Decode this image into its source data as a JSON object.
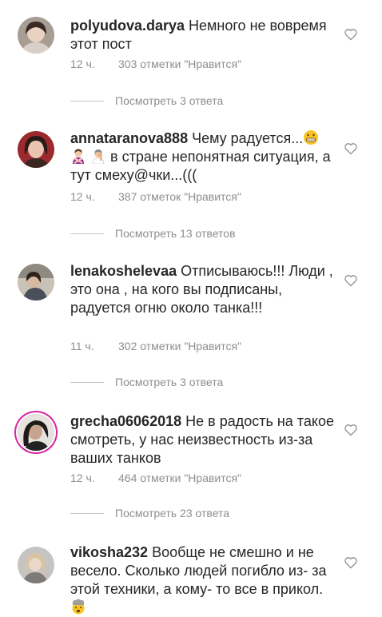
{
  "comments": [
    {
      "username": "polyudova.darya",
      "text": "Немного не вовремя этот пост",
      "time": "12 ч.",
      "likes": "303 отметки \"Нравится\"",
      "replies": "Посмотреть 3 ответа",
      "avatar_icon": "user-avatar-icon"
    },
    {
      "username": "annataranova888",
      "text_a": "Чему радуется...",
      "text_b": "в стране непонятная ситуация, а тут смеху@чки...(((",
      "emoji_1": "grimacing-face-emoji",
      "emoji_2": "woman-gesturing-no-emoji",
      "emoji_3": "woman-facepalming-emoji",
      "time": "12 ч.",
      "likes": "387 отметок \"Нравится\"",
      "replies": "Посмотреть 13 ответов",
      "avatar_icon": "user-avatar-icon"
    },
    {
      "username": "lenakoshelevaa",
      "text": "Отписываюсь!!! Люди , это она , на кого вы подписаны, радуется огню около танка!!!",
      "time": "11 ч.",
      "likes": "302 отметки \"Нравится\"",
      "replies": "Посмотреть 3 ответа",
      "avatar_icon": "user-avatar-icon"
    },
    {
      "username": "grecha06062018",
      "text": "Не в радость на такое смотреть,  у нас неизвестность из-за ваших танков",
      "time": "12 ч.",
      "likes": "464 отметки \"Нравится\"",
      "replies": "Посмотреть 23 ответа",
      "avatar_icon": "user-avatar-story-icon"
    },
    {
      "username": "vikosha232",
      "text": "Вообще не смешно и не весело. Сколько  людей погибло из- за этой техники, а кому- то все в прикол.",
      "emoji_1": "exploding-head-emoji",
      "avatar_icon": "user-avatar-icon"
    }
  ],
  "colors": {
    "text": "#262626",
    "secondary": "#8e8e8e",
    "divider": "#c7c7c7",
    "story_ring": "#d6249f"
  },
  "icons": {
    "like": "heart-outline-icon"
  }
}
